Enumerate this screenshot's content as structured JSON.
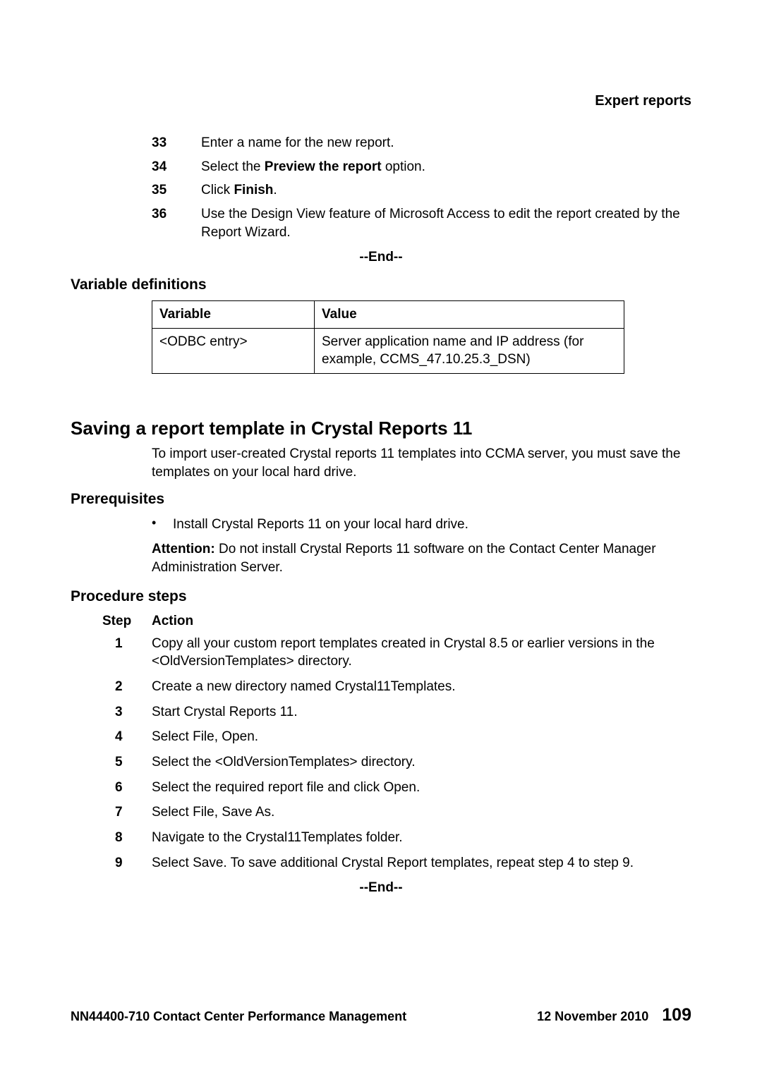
{
  "header": {
    "title": "Expert reports"
  },
  "steps_top": [
    {
      "num": "33",
      "text": "Enter a name for the new report."
    },
    {
      "num": "34",
      "prefix": "Select the ",
      "bold": "Preview the report",
      "suffix": " option."
    },
    {
      "num": "35",
      "prefix": "Click ",
      "bold": "Finish",
      "suffix": "."
    },
    {
      "num": "36",
      "text": "Use the Design View feature of Microsoft Access to edit the report created by the Report Wizard."
    }
  ],
  "end_label": "--End--",
  "vardefs": {
    "heading": "Variable definitions",
    "th_var": "Variable",
    "th_val": "Value",
    "row_var": "<ODBC entry>",
    "row_val": "Server application name and IP address (for example, CCMS_47.10.25.3_DSN)"
  },
  "section": {
    "title": "Saving a report template in Crystal Reports 11",
    "intro": "To import user-created Crystal reports 11 templates into CCMA server, you must save the templates on your local hard drive."
  },
  "prereq": {
    "heading": "Prerequisites",
    "bullet": "Install Crystal Reports 11 on your local hard drive.",
    "attention_label": "Attention:",
    "attention_text": "  Do not install Crystal Reports 11 software on the Contact Center Manager Administration Server."
  },
  "proc": {
    "heading": "Procedure steps",
    "step_h": "Step",
    "action_h": "Action",
    "items": [
      {
        "num": "1",
        "text": "Copy all your custom report templates created in Crystal 8.5 or earlier versions in the <OldVersionTemplates> directory."
      },
      {
        "num": "2",
        "text": "Create a new directory named Crystal11Templates."
      },
      {
        "num": "3",
        "text": "Start Crystal Reports 11."
      },
      {
        "num": "4",
        "prefix": "Select ",
        "bold1": "File",
        "mid": ", ",
        "bold2": "Open",
        "suffix": "."
      },
      {
        "num": "5",
        "text": "Select the <OldVersionTemplates> directory."
      },
      {
        "num": "6",
        "prefix": "Select the required report file and click ",
        "bold1": "Open",
        "suffix": "."
      },
      {
        "num": "7",
        "prefix": "Select ",
        "bold1": "File",
        "mid": ", ",
        "bold2": "Save As",
        "suffix": "."
      },
      {
        "num": "8",
        "prefix": "Navigate to the ",
        "bold1": "Crystal11Templates",
        "suffix": " folder."
      },
      {
        "num": "9",
        "prefix": "Select ",
        "bold1": "Save",
        "suffix": ". To save additional Crystal Report templates, repeat step 4 to step 9."
      }
    ]
  },
  "footer": {
    "left": "NN44400-710 Contact Center Performance Management",
    "date": "12 November 2010",
    "page": "109"
  }
}
